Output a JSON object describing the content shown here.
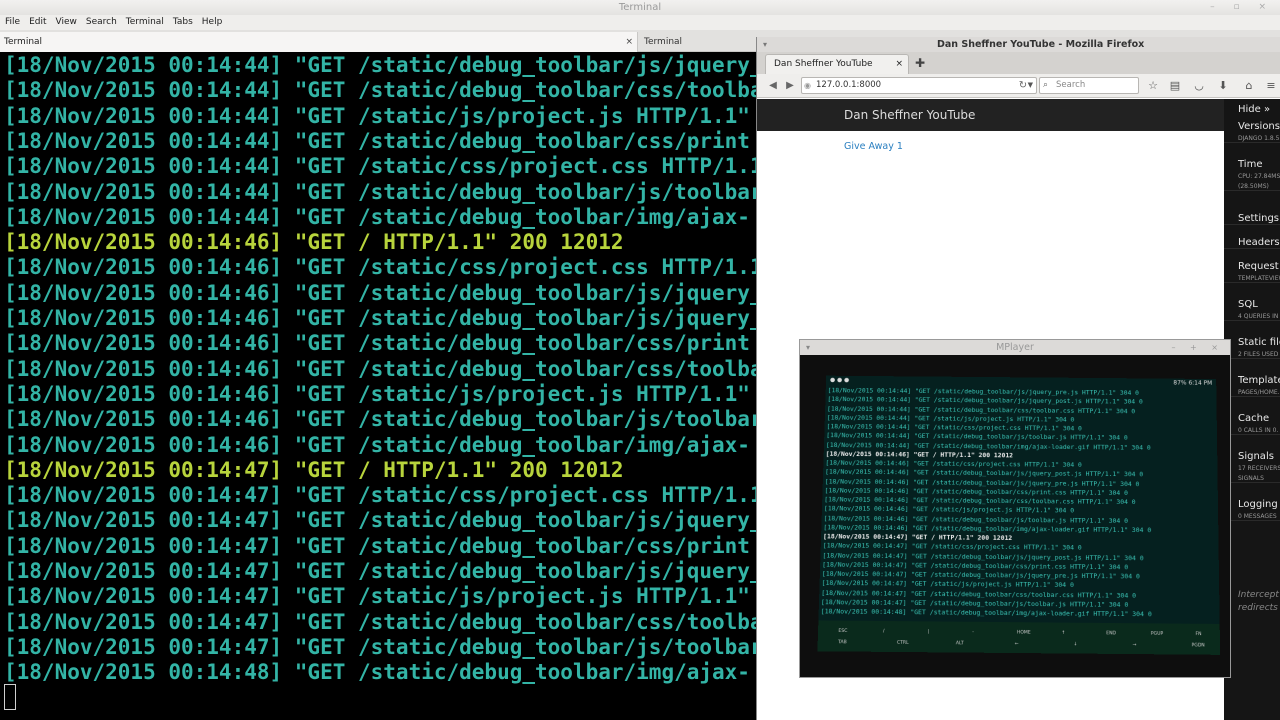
{
  "terminal": {
    "title": "Terminal",
    "menu": [
      "File",
      "Edit",
      "View",
      "Search",
      "Terminal",
      "Tabs",
      "Help"
    ],
    "tabs": [
      "Terminal",
      "Terminal"
    ],
    "lines": [
      {
        "text": "[18/Nov/2015 00:14:44] \"GET /static/debug_toolbar/js/jquery_",
        "hl": false
      },
      {
        "text": "[18/Nov/2015 00:14:44] \"GET /static/debug_toolbar/css/toolba",
        "hl": false
      },
      {
        "text": "[18/Nov/2015 00:14:44] \"GET /static/js/project.js HTTP/1.1\"",
        "hl": false
      },
      {
        "text": "[18/Nov/2015 00:14:44] \"GET /static/debug_toolbar/css/print",
        "hl": false
      },
      {
        "text": "[18/Nov/2015 00:14:44] \"GET /static/css/project.css HTTP/1.1",
        "hl": false
      },
      {
        "text": "[18/Nov/2015 00:14:44] \"GET /static/debug_toolbar/js/toolbar",
        "hl": false
      },
      {
        "text": "[18/Nov/2015 00:14:44] \"GET /static/debug_toolbar/img/ajax-",
        "hl": false
      },
      {
        "text": "[18/Nov/2015 00:14:46] \"GET / HTTP/1.1\" 200 12012",
        "hl": true
      },
      {
        "text": "[18/Nov/2015 00:14:46] \"GET /static/css/project.css HTTP/1.1",
        "hl": false
      },
      {
        "text": "[18/Nov/2015 00:14:46] \"GET /static/debug_toolbar/js/jquery_",
        "hl": false
      },
      {
        "text": "[18/Nov/2015 00:14:46] \"GET /static/debug_toolbar/js/jquery_",
        "hl": false
      },
      {
        "text": "[18/Nov/2015 00:14:46] \"GET /static/debug_toolbar/css/print",
        "hl": false
      },
      {
        "text": "[18/Nov/2015 00:14:46] \"GET /static/debug_toolbar/css/toolba",
        "hl": false
      },
      {
        "text": "[18/Nov/2015 00:14:46] \"GET /static/js/project.js HTTP/1.1\"",
        "hl": false
      },
      {
        "text": "[18/Nov/2015 00:14:46] \"GET /static/debug_toolbar/js/toolbar",
        "hl": false
      },
      {
        "text": "[18/Nov/2015 00:14:46] \"GET /static/debug_toolbar/img/ajax-",
        "hl": false
      },
      {
        "text": "[18/Nov/2015 00:14:47] \"GET / HTTP/1.1\" 200 12012",
        "hl": true
      },
      {
        "text": "[18/Nov/2015 00:14:47] \"GET /static/css/project.css HTTP/1.1",
        "hl": false
      },
      {
        "text": "[18/Nov/2015 00:14:47] \"GET /static/debug_toolbar/js/jquery_",
        "hl": false
      },
      {
        "text": "[18/Nov/2015 00:14:47] \"GET /static/debug_toolbar/css/print",
        "hl": false
      },
      {
        "text": "[18/Nov/2015 00:14:47] \"GET /static/debug_toolbar/js/jquery_",
        "hl": false
      },
      {
        "text": "[18/Nov/2015 00:14:47] \"GET /static/js/project.js HTTP/1.1\"",
        "hl": false
      },
      {
        "text": "[18/Nov/2015 00:14:47] \"GET /static/debug_toolbar/css/toolba",
        "hl": false
      },
      {
        "text": "[18/Nov/2015 00:14:47] \"GET /static/debug_toolbar/js/toolbar",
        "hl": false
      },
      {
        "text": "[18/Nov/2015 00:14:48] \"GET /static/debug_toolbar/img/ajax-",
        "hl": false
      }
    ],
    "colors": {
      "text": "#33b4a6",
      "highlight": "#b8d43c",
      "background": "#000000"
    }
  },
  "firefox": {
    "title": "Dan Sheffner YouTube - Mozilla Firefox",
    "tab_label": "Dan Sheffner YouTube",
    "url": "127.0.0.1:8000",
    "search_placeholder": "Search",
    "page": {
      "brand": "Dan Sheffner YouTube",
      "link": "Give Away 1"
    },
    "debug_toolbar": {
      "hide_label": "Hide »",
      "panels": [
        {
          "title": "Versions",
          "sub": "Django 1.8.5"
        },
        {
          "title": "Time",
          "sub": "CPU: 27.84ms",
          "sub2": "(28.50ms)"
        },
        {
          "title": "Settings",
          "sub": ""
        },
        {
          "title": "Headers",
          "sub": ""
        },
        {
          "title": "Request",
          "sub": "TemplateView"
        },
        {
          "title": "SQL",
          "sub": "4 queries in"
        },
        {
          "title": "Static files",
          "sub": "2 files used"
        },
        {
          "title": "Templates",
          "sub": "pages/home.h"
        },
        {
          "title": "Cache",
          "sub": "0 calls in 0."
        },
        {
          "title": "Signals",
          "sub": "17 receivers",
          "sub2": "signals"
        },
        {
          "title": "Logging",
          "sub": "0 messages"
        }
      ],
      "intercept_text": "Intercept redirects"
    }
  },
  "mplayer": {
    "title": "MPlayer",
    "status_time": "6:14 PM",
    "status_battery": "87%",
    "lines": [
      {
        "text": "[18/Nov/2015 00:14:44] \"GET /static/debug_toolbar/js/jquery_pre.js HTTP/1.1\" 304 0",
        "hl": false
      },
      {
        "text": "[18/Nov/2015 00:14:44] \"GET /static/debug_toolbar/js/jquery_post.js HTTP/1.1\" 304 0",
        "hl": false
      },
      {
        "text": "[18/Nov/2015 00:14:44] \"GET /static/debug_toolbar/css/toolbar.css HTTP/1.1\" 304 0",
        "hl": false
      },
      {
        "text": "[18/Nov/2015 00:14:44] \"GET /static/js/project.js HTTP/1.1\" 304 0",
        "hl": false
      },
      {
        "text": "[18/Nov/2015 00:14:44] \"GET /static/css/project.css HTTP/1.1\" 304 0",
        "hl": false
      },
      {
        "text": "[18/Nov/2015 00:14:44] \"GET /static/debug_toolbar/js/toolbar.js HTTP/1.1\" 304 0",
        "hl": false
      },
      {
        "text": "[18/Nov/2015 00:14:44] \"GET /static/debug_toolbar/img/ajax-loader.gif HTTP/1.1\" 304 0",
        "hl": false
      },
      {
        "text": "[18/Nov/2015 00:14:46] \"GET / HTTP/1.1\" 200 12012",
        "hl": true
      },
      {
        "text": "[18/Nov/2015 00:14:46] \"GET /static/css/project.css HTTP/1.1\" 304 0",
        "hl": false
      },
      {
        "text": "[18/Nov/2015 00:14:46] \"GET /static/debug_toolbar/js/jquery_post.js HTTP/1.1\" 304 0",
        "hl": false
      },
      {
        "text": "[18/Nov/2015 00:14:46] \"GET /static/debug_toolbar/js/jquery_pre.js HTTP/1.1\" 304 0",
        "hl": false
      },
      {
        "text": "[18/Nov/2015 00:14:46] \"GET /static/debug_toolbar/css/print.css HTTP/1.1\" 304 0",
        "hl": false
      },
      {
        "text": "[18/Nov/2015 00:14:46] \"GET /static/debug_toolbar/css/toolbar.css HTTP/1.1\" 304 0",
        "hl": false
      },
      {
        "text": "[18/Nov/2015 00:14:46] \"GET /static/js/project.js HTTP/1.1\" 304 0",
        "hl": false
      },
      {
        "text": "[18/Nov/2015 00:14:46] \"GET /static/debug_toolbar/js/toolbar.js HTTP/1.1\" 304 0",
        "hl": false
      },
      {
        "text": "[18/Nov/2015 00:14:46] \"GET /static/debug_toolbar/img/ajax-loader.gif HTTP/1.1\" 304 0",
        "hl": false
      },
      {
        "text": "[18/Nov/2015 00:14:47] \"GET / HTTP/1.1\" 200 12012",
        "hl": true
      },
      {
        "text": "[18/Nov/2015 00:14:47] \"GET /static/css/project.css HTTP/1.1\" 304 0",
        "hl": false
      },
      {
        "text": "[18/Nov/2015 00:14:47] \"GET /static/debug_toolbar/js/jquery_post.js HTTP/1.1\" 304 0",
        "hl": false
      },
      {
        "text": "[18/Nov/2015 00:14:47] \"GET /static/debug_toolbar/css/print.css HTTP/1.1\" 304 0",
        "hl": false
      },
      {
        "text": "[18/Nov/2015 00:14:47] \"GET /static/debug_toolbar/js/jquery_pre.js HTTP/1.1\" 304 0",
        "hl": false
      },
      {
        "text": "[18/Nov/2015 00:14:47] \"GET /static/js/project.js HTTP/1.1\" 304 0",
        "hl": false
      },
      {
        "text": "[18/Nov/2015 00:14:47] \"GET /static/debug_toolbar/css/toolbar.css HTTP/1.1\" 304 0",
        "hl": false
      },
      {
        "text": "[18/Nov/2015 00:14:47] \"GET /static/debug_toolbar/js/toolbar.js HTTP/1.1\" 304 0",
        "hl": false
      },
      {
        "text": "[18/Nov/2015 00:14:48] \"GET /static/debug_toolbar/img/ajax-loader.gif HTTP/1.1\" 304 0",
        "hl": false
      }
    ],
    "keys_row1": [
      "esc",
      "/",
      "|",
      "-",
      "home",
      "↑",
      "end",
      "pgup",
      "fn"
    ],
    "keys_row2": [
      "tab",
      "ctrl",
      "alt",
      "←",
      "↓",
      "→",
      "pgdn"
    ]
  }
}
